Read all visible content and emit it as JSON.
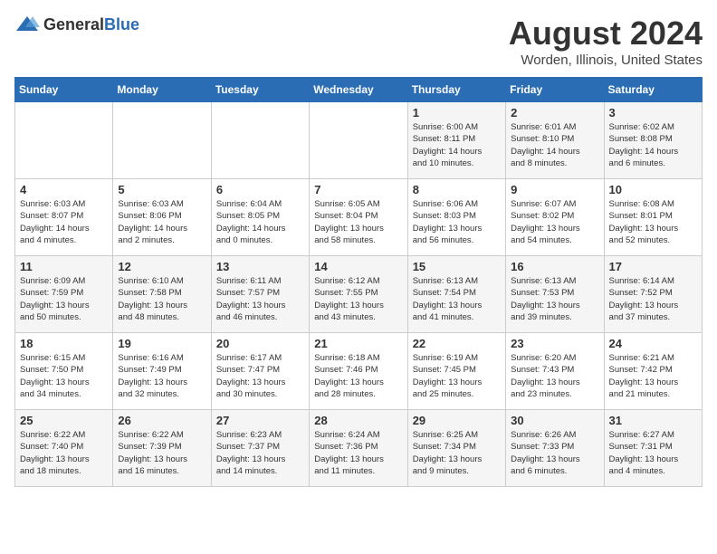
{
  "app": {
    "name_general": "General",
    "name_blue": "Blue"
  },
  "title": {
    "month_year": "August 2024",
    "location": "Worden, Illinois, United States"
  },
  "days_of_week": [
    "Sunday",
    "Monday",
    "Tuesday",
    "Wednesday",
    "Thursday",
    "Friday",
    "Saturday"
  ],
  "weeks": [
    [
      {
        "day": "",
        "info": ""
      },
      {
        "day": "",
        "info": ""
      },
      {
        "day": "",
        "info": ""
      },
      {
        "day": "",
        "info": ""
      },
      {
        "day": "1",
        "info": "Sunrise: 6:00 AM\nSunset: 8:11 PM\nDaylight: 14 hours\nand 10 minutes."
      },
      {
        "day": "2",
        "info": "Sunrise: 6:01 AM\nSunset: 8:10 PM\nDaylight: 14 hours\nand 8 minutes."
      },
      {
        "day": "3",
        "info": "Sunrise: 6:02 AM\nSunset: 8:08 PM\nDaylight: 14 hours\nand 6 minutes."
      }
    ],
    [
      {
        "day": "4",
        "info": "Sunrise: 6:03 AM\nSunset: 8:07 PM\nDaylight: 14 hours\nand 4 minutes."
      },
      {
        "day": "5",
        "info": "Sunrise: 6:03 AM\nSunset: 8:06 PM\nDaylight: 14 hours\nand 2 minutes."
      },
      {
        "day": "6",
        "info": "Sunrise: 6:04 AM\nSunset: 8:05 PM\nDaylight: 14 hours\nand 0 minutes."
      },
      {
        "day": "7",
        "info": "Sunrise: 6:05 AM\nSunset: 8:04 PM\nDaylight: 13 hours\nand 58 minutes."
      },
      {
        "day": "8",
        "info": "Sunrise: 6:06 AM\nSunset: 8:03 PM\nDaylight: 13 hours\nand 56 minutes."
      },
      {
        "day": "9",
        "info": "Sunrise: 6:07 AM\nSunset: 8:02 PM\nDaylight: 13 hours\nand 54 minutes."
      },
      {
        "day": "10",
        "info": "Sunrise: 6:08 AM\nSunset: 8:01 PM\nDaylight: 13 hours\nand 52 minutes."
      }
    ],
    [
      {
        "day": "11",
        "info": "Sunrise: 6:09 AM\nSunset: 7:59 PM\nDaylight: 13 hours\nand 50 minutes."
      },
      {
        "day": "12",
        "info": "Sunrise: 6:10 AM\nSunset: 7:58 PM\nDaylight: 13 hours\nand 48 minutes."
      },
      {
        "day": "13",
        "info": "Sunrise: 6:11 AM\nSunset: 7:57 PM\nDaylight: 13 hours\nand 46 minutes."
      },
      {
        "day": "14",
        "info": "Sunrise: 6:12 AM\nSunset: 7:55 PM\nDaylight: 13 hours\nand 43 minutes."
      },
      {
        "day": "15",
        "info": "Sunrise: 6:13 AM\nSunset: 7:54 PM\nDaylight: 13 hours\nand 41 minutes."
      },
      {
        "day": "16",
        "info": "Sunrise: 6:13 AM\nSunset: 7:53 PM\nDaylight: 13 hours\nand 39 minutes."
      },
      {
        "day": "17",
        "info": "Sunrise: 6:14 AM\nSunset: 7:52 PM\nDaylight: 13 hours\nand 37 minutes."
      }
    ],
    [
      {
        "day": "18",
        "info": "Sunrise: 6:15 AM\nSunset: 7:50 PM\nDaylight: 13 hours\nand 34 minutes."
      },
      {
        "day": "19",
        "info": "Sunrise: 6:16 AM\nSunset: 7:49 PM\nDaylight: 13 hours\nand 32 minutes."
      },
      {
        "day": "20",
        "info": "Sunrise: 6:17 AM\nSunset: 7:47 PM\nDaylight: 13 hours\nand 30 minutes."
      },
      {
        "day": "21",
        "info": "Sunrise: 6:18 AM\nSunset: 7:46 PM\nDaylight: 13 hours\nand 28 minutes."
      },
      {
        "day": "22",
        "info": "Sunrise: 6:19 AM\nSunset: 7:45 PM\nDaylight: 13 hours\nand 25 minutes."
      },
      {
        "day": "23",
        "info": "Sunrise: 6:20 AM\nSunset: 7:43 PM\nDaylight: 13 hours\nand 23 minutes."
      },
      {
        "day": "24",
        "info": "Sunrise: 6:21 AM\nSunset: 7:42 PM\nDaylight: 13 hours\nand 21 minutes."
      }
    ],
    [
      {
        "day": "25",
        "info": "Sunrise: 6:22 AM\nSunset: 7:40 PM\nDaylight: 13 hours\nand 18 minutes."
      },
      {
        "day": "26",
        "info": "Sunrise: 6:22 AM\nSunset: 7:39 PM\nDaylight: 13 hours\nand 16 minutes."
      },
      {
        "day": "27",
        "info": "Sunrise: 6:23 AM\nSunset: 7:37 PM\nDaylight: 13 hours\nand 14 minutes."
      },
      {
        "day": "28",
        "info": "Sunrise: 6:24 AM\nSunset: 7:36 PM\nDaylight: 13 hours\nand 11 minutes."
      },
      {
        "day": "29",
        "info": "Sunrise: 6:25 AM\nSunset: 7:34 PM\nDaylight: 13 hours\nand 9 minutes."
      },
      {
        "day": "30",
        "info": "Sunrise: 6:26 AM\nSunset: 7:33 PM\nDaylight: 13 hours\nand 6 minutes."
      },
      {
        "day": "31",
        "info": "Sunrise: 6:27 AM\nSunset: 7:31 PM\nDaylight: 13 hours\nand 4 minutes."
      }
    ]
  ]
}
